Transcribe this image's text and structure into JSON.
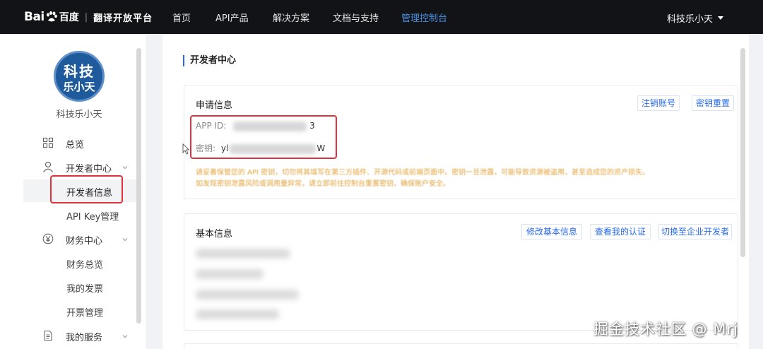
{
  "topbar": {
    "logo_text": "Bai",
    "logo_cn": "百度",
    "logo_sep": "|",
    "platform": "翻译开放平台",
    "nav": [
      "首页",
      "API产品",
      "解决方案",
      "文档与支持",
      "管理控制台"
    ],
    "active_nav": "管理控制台",
    "user": "科技乐小天"
  },
  "sidebar": {
    "avatar_line1": "科技",
    "avatar_line2": "乐小天",
    "username": "科技乐小天",
    "items": [
      {
        "label": "总览",
        "icon": "grid-icon"
      },
      {
        "label": "开发者中心",
        "icon": "user-icon"
      },
      {
        "label": "开发者信息"
      },
      {
        "label": "API Key管理"
      },
      {
        "label": "财务中心",
        "icon": "yen-icon"
      },
      {
        "label": "财务总览"
      },
      {
        "label": "我的发票"
      },
      {
        "label": "开票管理"
      },
      {
        "label": "我的服务",
        "icon": "document-icon"
      }
    ]
  },
  "main": {
    "page_title": "开发者中心",
    "apply_card": {
      "title": "申请信息",
      "btn_cancel": "注销账号",
      "btn_reset": "密钥重置",
      "appid_label": "APP ID:",
      "appid_suffix": "3",
      "key_label": "密钥:",
      "key_prefix": "yl",
      "key_suffix": "W",
      "notice1": "请妥善保管您的 API 密钥，切勿将其填写在第三方插件、开源代码或前端页面中。密钥一旦泄露，可能导致资源被盗用，甚至造成您的资产损失。",
      "notice2": "如发现密钥泄露风险或调用量异常，请立即前往控制台重置密钥，确保账户安全。"
    },
    "basic_card": {
      "title": "基本信息",
      "btn_edit": "修改基本信息",
      "btn_verify": "查看我的认证",
      "btn_switch": "切换至企业开发者"
    }
  },
  "watermark": "掘金技术社区 @ Mrj",
  "colors": {
    "topbar_bg": "#111317",
    "accent": "#2468f2",
    "highlight_red": "#e0323c",
    "notice_orange": "#e2a33c"
  }
}
